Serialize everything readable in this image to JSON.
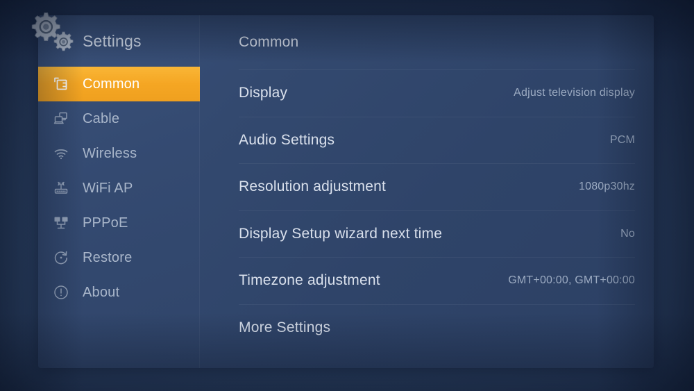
{
  "app": {
    "title": "Settings",
    "decoration_icon": "gears-icon",
    "accent_color": "#f5a623",
    "panel_color": "#33496f",
    "background_color": "#2b4063"
  },
  "sidebar": {
    "title": "Settings",
    "items": [
      {
        "label": "Common",
        "icon": "cards-icon",
        "selected": true
      },
      {
        "label": "Cable",
        "icon": "computers-icon",
        "selected": false
      },
      {
        "label": "Wireless",
        "icon": "wifi-icon",
        "selected": false
      },
      {
        "label": "WiFi AP",
        "icon": "router-icon",
        "selected": false
      },
      {
        "label": "PPPoE",
        "icon": "network-icon",
        "selected": false
      },
      {
        "label": "Restore",
        "icon": "refresh-icon",
        "selected": false
      },
      {
        "label": "About",
        "icon": "info-icon",
        "selected": false
      }
    ]
  },
  "main": {
    "title": "Common",
    "rows": [
      {
        "label": "Display",
        "value": "Adjust television display"
      },
      {
        "label": "Audio Settings",
        "value": "PCM"
      },
      {
        "label": "Resolution adjustment",
        "value": "1080p30hz"
      },
      {
        "label": "Display Setup wizard next time",
        "value": "No"
      },
      {
        "label": "Timezone adjustment",
        "value": "GMT+00:00, GMT+00:00"
      },
      {
        "label": "More Settings",
        "value": ""
      }
    ]
  }
}
